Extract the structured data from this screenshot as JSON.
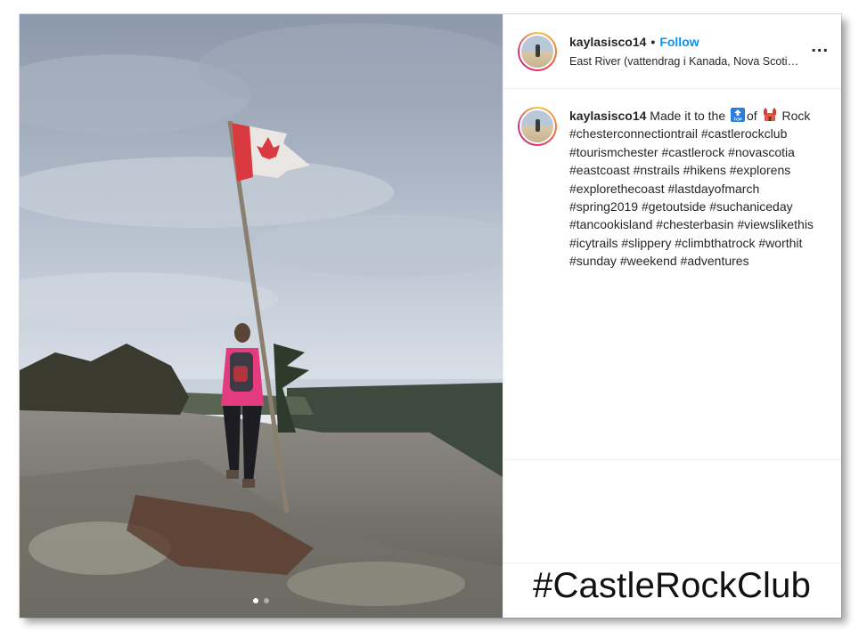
{
  "post": {
    "username": "kaylasisco14",
    "separator": "•",
    "follow_label": "Follow",
    "location": "East River (vattendrag i Kanada, Nova Scotia, ...",
    "more_label": "..."
  },
  "caption": {
    "username": "kaylasisco14",
    "text_part1": "Made it to the",
    "emoji_top": "top-arrow-emoji",
    "text_part2": "of",
    "emoji_castle": "castle-emoji",
    "text_part3": "Rock #chesterconnectiontrail #castlerockclub #tourismchester #castlerock #novascotia #eastcoast #nstrails #hikens #explorens #explorethecoast #lastdayofmarch #spring2019 #getoutside #suchaniceday #tancookisland #chesterbasin #viewslikethis #icytrails #slippery #climbthatrock #worthit #sunday #weekend #adventures"
  },
  "carousel": {
    "slide_count": 2,
    "active_index": 0
  },
  "banner": {
    "text": "#CastleRockClub"
  },
  "colors": {
    "follow": "#0095f6",
    "text": "#262626",
    "divider": "#efefef"
  }
}
